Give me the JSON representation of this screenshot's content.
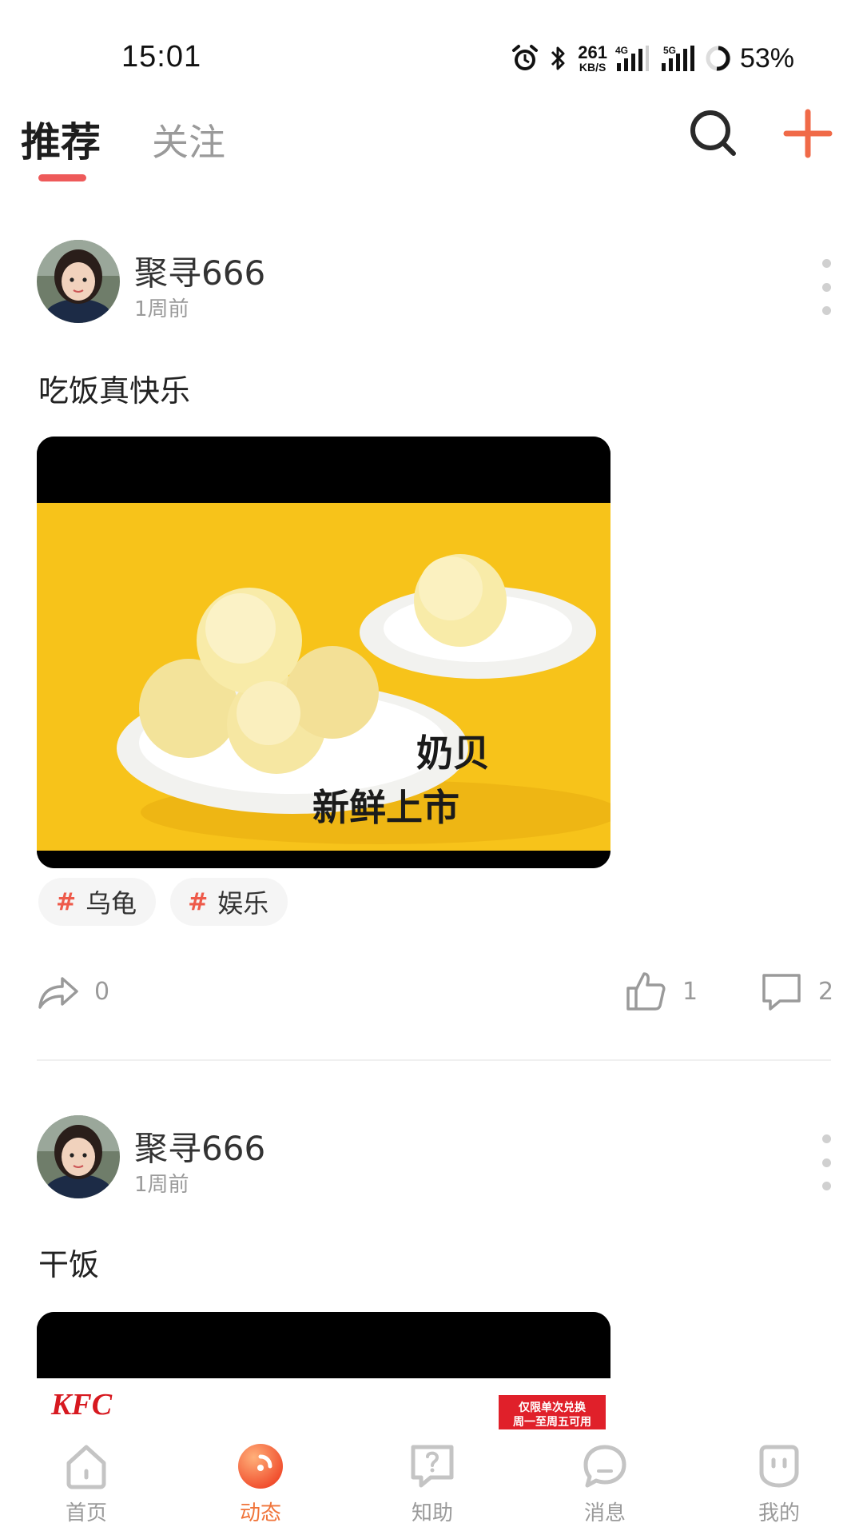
{
  "status_bar": {
    "time": "15:01",
    "net_speed_value": "261",
    "net_speed_unit": "KB/S",
    "sim1": "4G",
    "sim2": "5G",
    "battery": "53%"
  },
  "top_nav": {
    "tabs": [
      {
        "label": "推荐",
        "active": true
      },
      {
        "label": "关注",
        "active": false
      }
    ],
    "accent": "#ee5a5a"
  },
  "posts": [
    {
      "username": "聚寻666",
      "time": "1周前",
      "text": "吃饭真快乐",
      "image_caption_line1": "奶贝",
      "image_caption_line2": "新鲜上市",
      "tags": [
        "乌龟",
        "娱乐"
      ],
      "share_count": "0",
      "like_count": "1",
      "comment_count": "2"
    },
    {
      "username": "聚寻666",
      "time": "1周前",
      "text": "干饭",
      "image_logo": "KFC",
      "image_badge_line1": "仅限单次兑换",
      "image_badge_line2": "周一至周五可用"
    }
  ],
  "bottom_nav": {
    "items": [
      {
        "label": "首页",
        "icon": "home-icon",
        "active": false
      },
      {
        "label": "动态",
        "icon": "feed-icon",
        "active": true
      },
      {
        "label": "知助",
        "icon": "question-icon",
        "active": false
      },
      {
        "label": "消息",
        "icon": "message-icon",
        "active": false
      },
      {
        "label": "我的",
        "icon": "profile-icon",
        "active": false
      }
    ],
    "active_color": "#f0743a"
  }
}
